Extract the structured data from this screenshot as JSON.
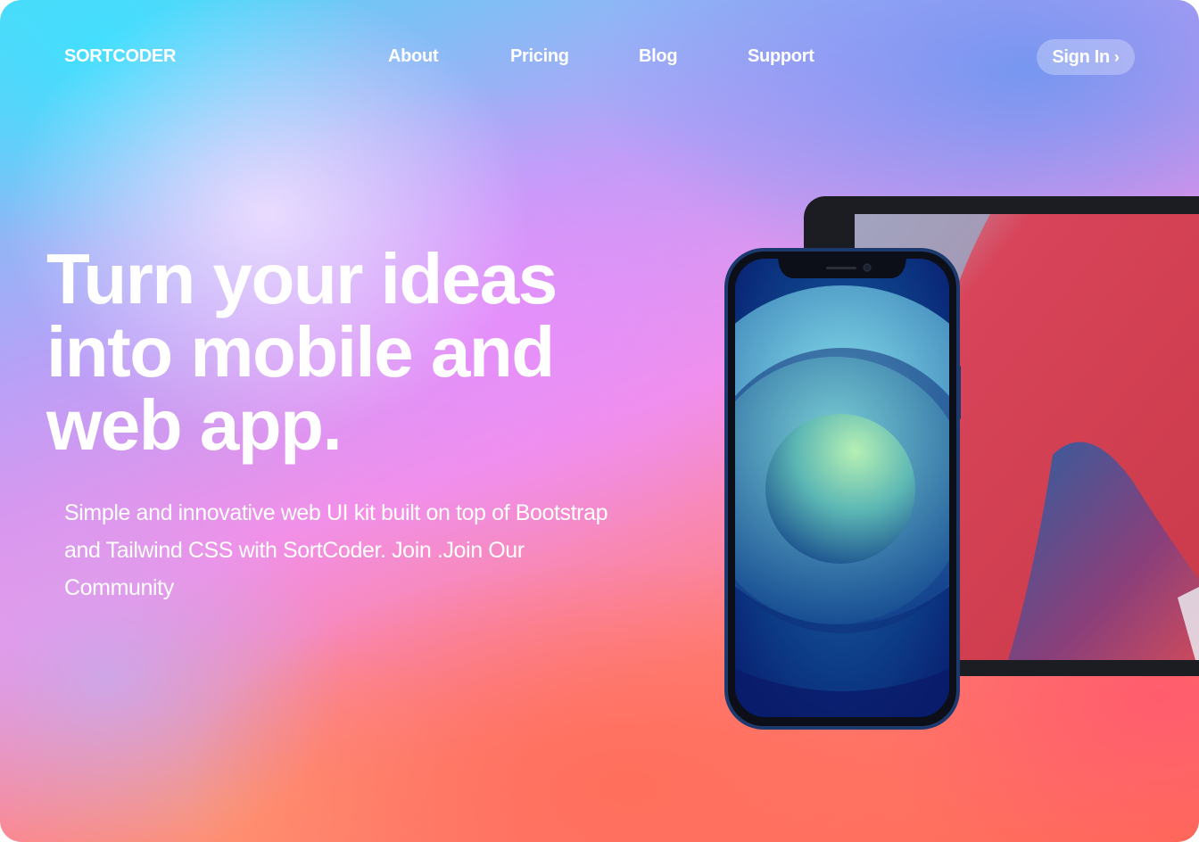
{
  "header": {
    "logo": "SORTCODER",
    "nav": [
      {
        "label": "About"
      },
      {
        "label": "Pricing"
      },
      {
        "label": "Blog"
      },
      {
        "label": "Support"
      }
    ],
    "signin_label": "Sign In",
    "signin_icon": "chevron-right-icon"
  },
  "hero": {
    "title": "Turn your ideas\ninto mobile  and\nweb app.",
    "subtitle": "Simple and innovative web UI kit built on top of Bootstrap and Tailwind CSS with SortCoder. Join .Join Our Community"
  },
  "illustration": {
    "devices": [
      "tablet",
      "phone"
    ]
  },
  "colors": {
    "text": "#ffffff",
    "button_bg": "rgba(255,255,255,0.28)",
    "phone_frame": "#1d3a6e",
    "tablet_frame": "#1b1d22"
  }
}
